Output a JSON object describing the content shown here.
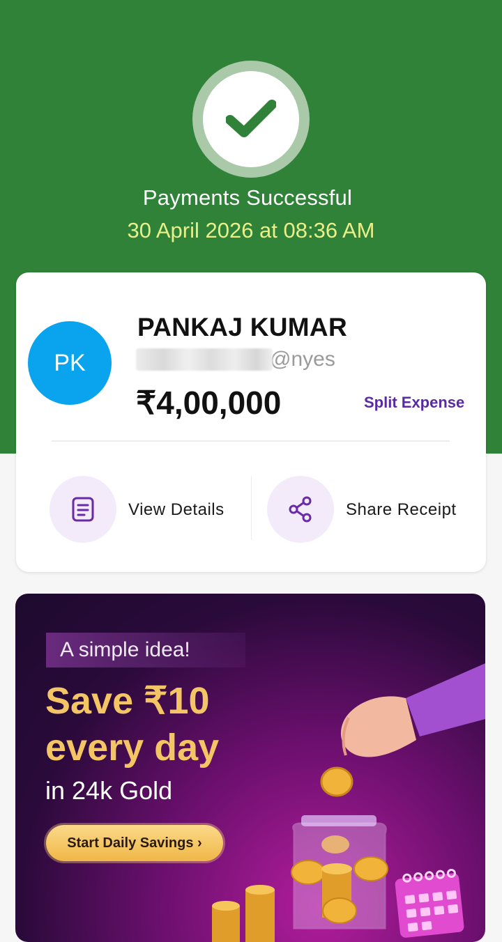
{
  "status": {
    "title": "Payments Successful",
    "datetime": "30 April 2026 at 08:36 AM"
  },
  "payee": {
    "initials": "PK",
    "name": "PANKAJ KUMAR",
    "upi_suffix": "@nyes",
    "amount": "₹4,00,000",
    "split_label": "Split Expense"
  },
  "actions": {
    "view_details": "View Details",
    "share_receipt": "Share Receipt"
  },
  "banner": {
    "tag": "A simple idea!",
    "headline_1": "Save ₹10",
    "headline_2": "every day",
    "subline": "in 24k Gold",
    "cta": "Start Daily Savings ›"
  },
  "colors": {
    "success_green": "#2f8238",
    "accent_purple": "#5a2aa0",
    "avatar_blue": "#0aa4ee",
    "date_yellow": "#e9f08a"
  }
}
